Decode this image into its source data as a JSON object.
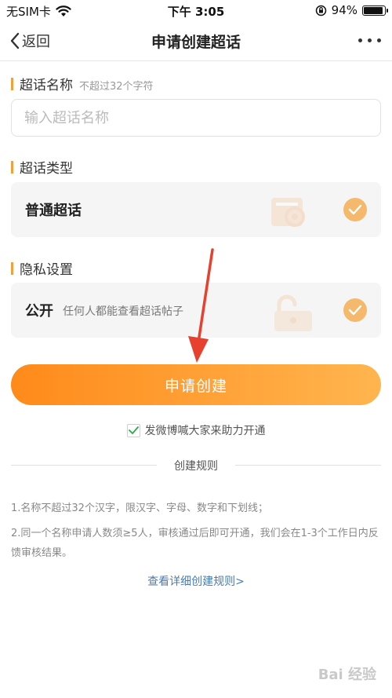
{
  "status_bar": {
    "carrier": "无SIM卡",
    "time": "下午 3:05",
    "battery_text": "94%",
    "battery_level": 0.94
  },
  "nav": {
    "back_label": "返回",
    "title": "申请创建超话"
  },
  "name_section": {
    "label": "超话名称",
    "hint": "不超过32个字符",
    "placeholder": "输入超话名称",
    "value": ""
  },
  "type_section": {
    "label": "超话类型",
    "option_title": "普通超话",
    "selected": true
  },
  "privacy_section": {
    "label": "隐私设置",
    "option_title": "公开",
    "option_desc": "任何人都能查看超话帖子",
    "selected": true
  },
  "submit_label": "申请创建",
  "agree": {
    "label": "发微博喊大家来助力开通",
    "checked": true
  },
  "rules": {
    "title": "创建规则",
    "items": [
      "1.名称不超过32个汉字，限汉字、字母、数字和下划线；",
      "2.同一个名称申请人数须≥5人，审核通过后即可开通，我们会在1-3个工作日内反馈审核结果。"
    ],
    "link": "查看详细创建规则>"
  },
  "watermark": "Bai 经验",
  "colors": {
    "accent": "#ff8a1a",
    "check": "#f5b96e",
    "link": "#4a7cb6",
    "arrow": "#e8402f"
  }
}
